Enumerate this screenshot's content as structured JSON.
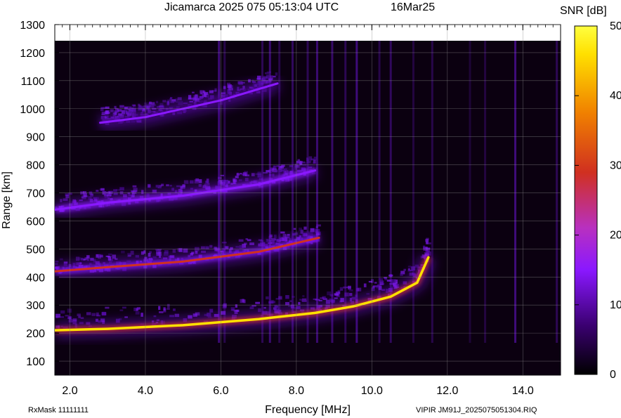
{
  "header": {
    "title": "Jicamarca 2025 075 05:13:04 UTC",
    "date": "16Mar25"
  },
  "footer": {
    "rxmask": "RxMask 11111111",
    "file": "VIPIR  JM91J_2025075051304.RIQ"
  },
  "chart_data": {
    "type": "heatmap",
    "title": "Jicamarca 2025 075 05:13:04 UTC",
    "xlabel": "Frequency [MHz]",
    "ylabel": "Range [km]",
    "xlim": [
      1.6,
      15.0
    ],
    "ylim": [
      50,
      1300
    ],
    "x_ticks": [
      2.0,
      4.0,
      6.0,
      8.0,
      10.0,
      12.0,
      14.0
    ],
    "x_tick_labels": [
      "2.0",
      "4.0",
      "6.0",
      "8.0",
      "10.0",
      "12.0",
      "14.0"
    ],
    "y_ticks": [
      100,
      200,
      300,
      400,
      500,
      600,
      700,
      800,
      900,
      1000,
      1100,
      1200,
      1300
    ],
    "y_tick_labels": [
      "100",
      "200",
      "300",
      "400",
      "500",
      "600",
      "700",
      "800",
      "900",
      "1000",
      "1100",
      "1200",
      "1300"
    ],
    "grid": true,
    "colorbar": {
      "label": "SNR [dB]",
      "range": [
        0,
        50
      ],
      "ticks": [
        0,
        10,
        20,
        30,
        40,
        50
      ],
      "tick_labels": [
        "0",
        "10",
        "20",
        "30",
        "40",
        "50"
      ],
      "colors": [
        "#000000",
        "#3a0070",
        "#8a18ff",
        "#b830c0",
        "#d03020",
        "#f08000",
        "#ffe000",
        "#ffff40"
      ]
    },
    "echo_traces": [
      {
        "points": [
          [
            1.6,
            210
          ],
          [
            3.0,
            215
          ],
          [
            5.0,
            228
          ],
          [
            7.0,
            250
          ],
          [
            8.5,
            272
          ],
          [
            9.5,
            295
          ],
          [
            10.5,
            330
          ],
          [
            11.2,
            380
          ],
          [
            11.5,
            470
          ]
        ],
        "snr": 42
      },
      {
        "points": [
          [
            1.6,
            420
          ],
          [
            3.0,
            435
          ],
          [
            5.0,
            455
          ],
          [
            7.0,
            490
          ],
          [
            8.6,
            540
          ]
        ],
        "snr": 22
      },
      {
        "points": [
          [
            1.6,
            640
          ],
          [
            3.0,
            665
          ],
          [
            5.0,
            690
          ],
          [
            7.0,
            730
          ],
          [
            8.5,
            780
          ]
        ],
        "snr": 14
      },
      {
        "points": [
          [
            2.8,
            950
          ],
          [
            4.0,
            970
          ],
          [
            6.0,
            1030
          ],
          [
            7.5,
            1090
          ]
        ],
        "snr": 11
      }
    ]
  }
}
